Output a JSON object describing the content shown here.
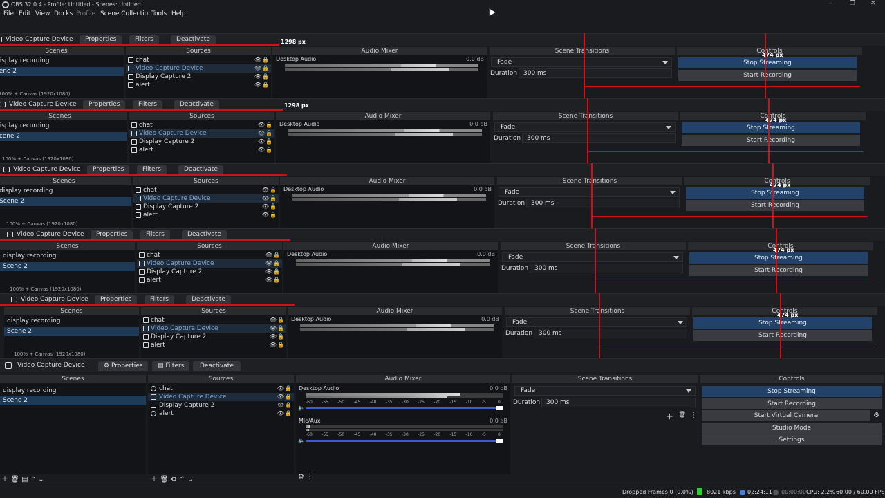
{
  "window": {
    "title": "OBS 32.0.4 - Profile: Untitled - Scenes: Untitled"
  },
  "menu": [
    {
      "label": "File",
      "enabled": true
    },
    {
      "label": "Edit",
      "enabled": true
    },
    {
      "label": "View",
      "enabled": true
    },
    {
      "label": "Docks",
      "enabled": true
    },
    {
      "label": "Profile",
      "enabled": false
    },
    {
      "label": "Scene Collection",
      "enabled": true
    },
    {
      "label": "Tools",
      "enabled": true
    },
    {
      "label": "Help",
      "enabled": true
    }
  ],
  "source_toolbar": {
    "source_name": "Video Capture Device",
    "properties_label": "Properties",
    "filters_label": "Filters",
    "deactivate_label": "Deactivate"
  },
  "zoom": {
    "percent": "100%",
    "canvas": "Canvas (1920x1080)"
  },
  "measure_labels": {
    "width": "1298 px",
    "height": "474 px"
  },
  "docks": {
    "scenes": {
      "title": "Scenes",
      "items": [
        "display recording",
        "Scene 2"
      ],
      "selected": "Scene 2"
    },
    "sources": {
      "title": "Sources",
      "items": [
        {
          "name": "chat",
          "icon": "globe-icon"
        },
        {
          "name": "Video Capture Device",
          "icon": "camera-icon"
        },
        {
          "name": "Display Capture 2",
          "icon": "monitor-icon"
        },
        {
          "name": "alert",
          "icon": "globe-icon"
        }
      ],
      "selected": "Video Capture Device"
    },
    "audio": {
      "title": "Audio Mixer",
      "tracks": [
        {
          "name": "Desktop Audio",
          "db": "0.0 dB",
          "level": 0.78
        },
        {
          "name": "Mic/Aux",
          "db": "0.0 dB",
          "level": 0.02
        }
      ],
      "scale": [
        "-60",
        "-55",
        "-50",
        "-45",
        "-40",
        "-35",
        "-30",
        "-25",
        "-20",
        "-15",
        "-10",
        "-5",
        "0"
      ]
    },
    "transitions": {
      "title": "Scene Transitions",
      "selected": "Fade",
      "duration_label": "Duration",
      "duration_value": "300 ms"
    },
    "controls": {
      "title": "Controls",
      "buttons": [
        {
          "label": "Stop Streaming",
          "active": true
        },
        {
          "label": "Start Recording",
          "active": false
        },
        {
          "label": "Start Virtual Camera",
          "active": false
        },
        {
          "label": "Studio Mode",
          "active": false
        },
        {
          "label": "Settings",
          "active": false
        }
      ]
    }
  },
  "status": {
    "dropped_frames": "Dropped Frames 0 (0.0%)",
    "bitrate": "8021 kbps",
    "stream_time": "02:24:11",
    "rec_time": "00:00:00",
    "cpu": "CPU: 2.2%",
    "fps": "60.00 / 60.00 FPS"
  },
  "colors": {
    "accent": "#22426a",
    "highlight": "#d0101a",
    "meter_fader": "#3d5bd6"
  }
}
